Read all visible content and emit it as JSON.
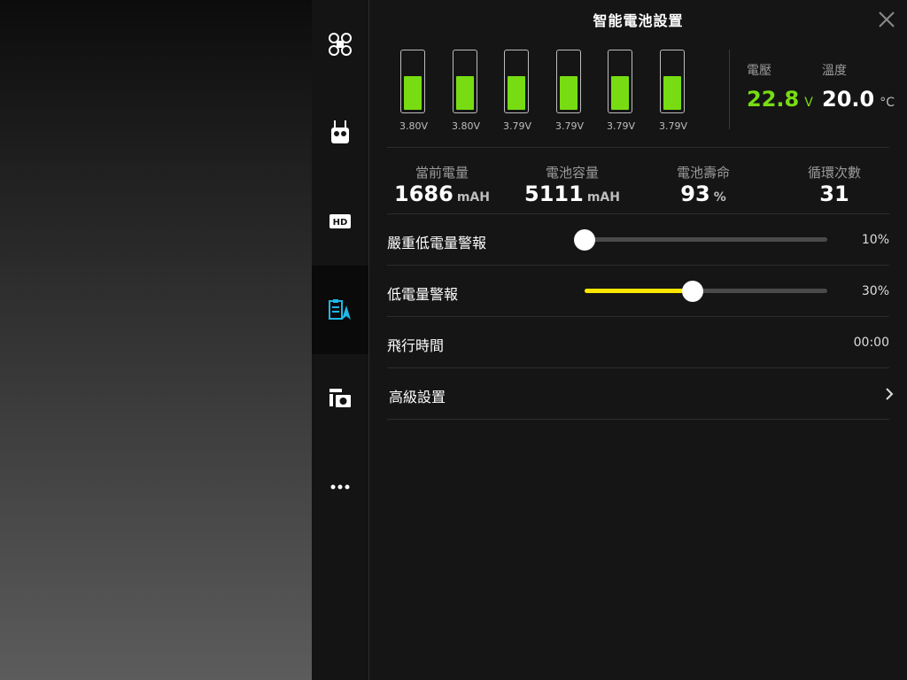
{
  "panel": {
    "title": "智能電池設置"
  },
  "sidebar": {
    "items": [
      {
        "icon": "drone-icon",
        "active": false
      },
      {
        "icon": "remote-controller-icon",
        "active": false
      },
      {
        "icon": "hd-icon",
        "label": "HD",
        "active": false
      },
      {
        "icon": "battery-settings-icon",
        "active": true
      },
      {
        "icon": "gimbal-camera-icon",
        "active": false
      },
      {
        "icon": "more-icon",
        "active": false
      }
    ]
  },
  "cells": [
    {
      "voltage": "3.80V",
      "level": 0.57
    },
    {
      "voltage": "3.80V",
      "level": 0.57
    },
    {
      "voltage": "3.79V",
      "level": 0.57
    },
    {
      "voltage": "3.79V",
      "level": 0.57
    },
    {
      "voltage": "3.79V",
      "level": 0.57
    },
    {
      "voltage": "3.79V",
      "level": 0.57
    }
  ],
  "voltage": {
    "label": "電壓",
    "value": "22.8",
    "unit": "V"
  },
  "temperature": {
    "label": "溫度",
    "value": "20.0",
    "unit": "°C"
  },
  "stats": {
    "current_charge": {
      "label": "當前電量",
      "value": "1686",
      "unit": "mAH"
    },
    "capacity": {
      "label": "電池容量",
      "value": "5111",
      "unit": "mAH"
    },
    "life": {
      "label": "電池壽命",
      "value": "93",
      "unit": "%"
    },
    "cycles": {
      "label": "循環次數",
      "value": "31"
    }
  },
  "critical_low_alert": {
    "label": "嚴重低電量警報",
    "value": "10%",
    "percent": 10
  },
  "low_alert": {
    "label": "低電量警報",
    "value": "30%",
    "percent": 30
  },
  "flight_time": {
    "label": "飛行時間",
    "value": "00:00"
  },
  "advanced": {
    "label": "高級設置"
  },
  "colors": {
    "accent_green": "#77dd12",
    "accent_yellow": "#ffe600",
    "active_icon": "#1fb7e8"
  }
}
